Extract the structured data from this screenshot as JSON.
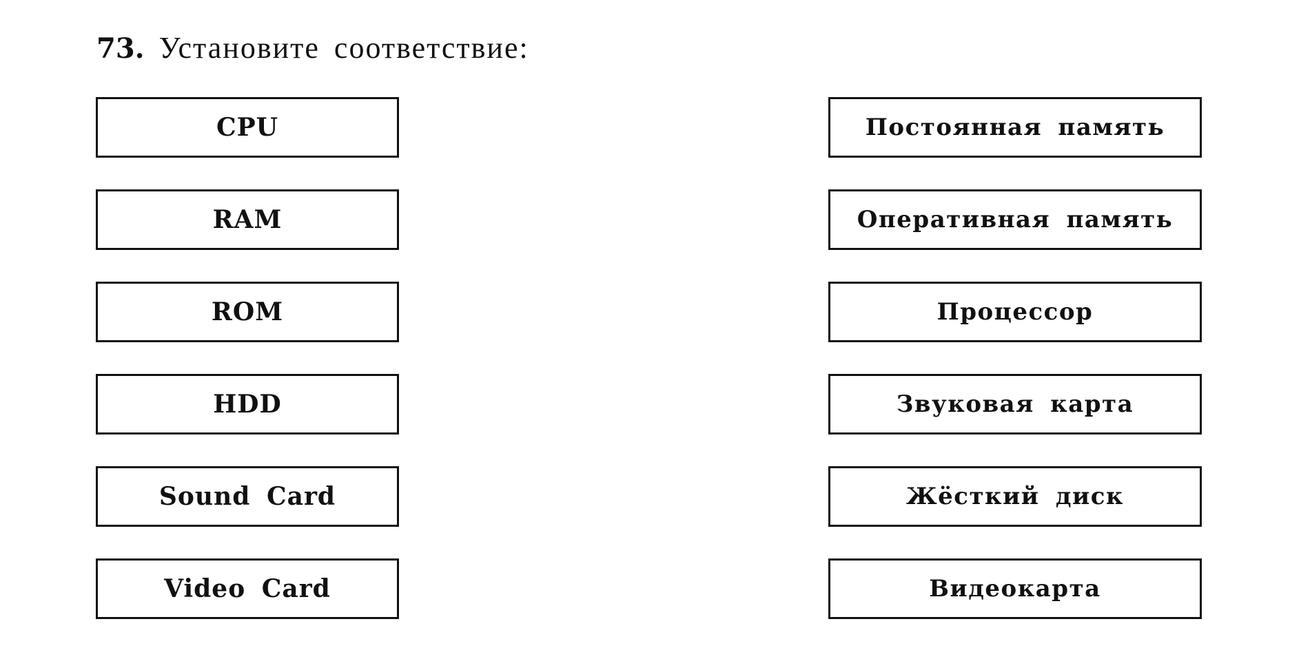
{
  "task": {
    "number": "73.",
    "title": "Установите соответствие:"
  },
  "left_column": {
    "items": [
      {
        "label": "CPU"
      },
      {
        "label": "RAM"
      },
      {
        "label": "ROM"
      },
      {
        "label": "HDD"
      },
      {
        "label": "Sound Card"
      },
      {
        "label": "Video Card"
      }
    ]
  },
  "right_column": {
    "items": [
      {
        "label": "Постоянная память"
      },
      {
        "label": "Оперативная память"
      },
      {
        "label": "Процессор"
      },
      {
        "label": "Звуковая карта"
      },
      {
        "label": "Жёсткий диск"
      },
      {
        "label": "Видеокарта"
      }
    ]
  }
}
